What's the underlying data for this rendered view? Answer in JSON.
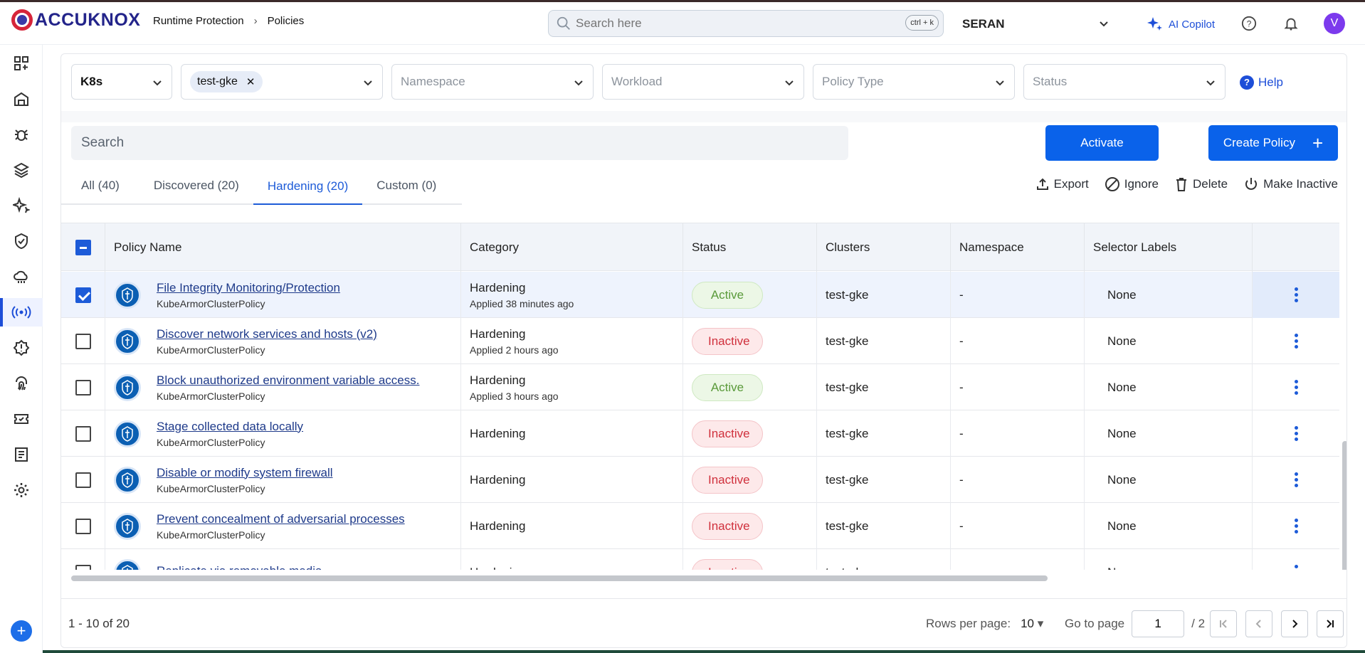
{
  "brand": {
    "name": "ACCUKNOX"
  },
  "breadcrumb": {
    "parent": "Runtime Protection",
    "current": "Policies"
  },
  "search": {
    "placeholder": "Search here",
    "shortcut": "ctrl + k"
  },
  "tenant": "SERAN",
  "copilot": "AI Copilot",
  "user_initial": "V",
  "sidebar": {
    "items": [
      "dashboard-icon",
      "inventory-icon",
      "bug-icon",
      "layers-icon",
      "sparkle-icon",
      "shield-check-icon",
      "cloud-icon",
      "runtime-icon",
      "alert-icon",
      "fingerprint-icon",
      "ticket-icon",
      "report-icon",
      "settings-icon"
    ],
    "active": "runtime-icon"
  },
  "filters": {
    "platform": "K8s",
    "cluster_chip": "test-gke",
    "namespace": "Namespace",
    "workload": "Workload",
    "policy_type": "Policy Type",
    "status": "Status",
    "help": "Help"
  },
  "search2": {
    "placeholder": "Search"
  },
  "buttons": {
    "activate": "Activate",
    "create": "Create Policy"
  },
  "tabs": [
    {
      "label": "All (40)"
    },
    {
      "label": "Discovered (20)"
    },
    {
      "label": "Hardening (20)",
      "active": true
    },
    {
      "label": "Custom (0)"
    }
  ],
  "actions": {
    "export": "Export",
    "ignore": "Ignore",
    "delete": "Delete",
    "inactive": "Make Inactive"
  },
  "columns": [
    "Policy Name",
    "Category",
    "Status",
    "Clusters",
    "Namespace",
    "Selector Labels"
  ],
  "rows": [
    {
      "name": "File Integrity Monitoring/Protection",
      "type": "KubeArmorClusterPolicy",
      "category": "Hardening",
      "applied": "Applied 38 minutes ago",
      "status": "Active",
      "cluster": "test-gke",
      "namespace": "-",
      "selector": "None",
      "checked": true
    },
    {
      "name": "Discover network services and hosts (v2)",
      "type": "KubeArmorClusterPolicy",
      "category": "Hardening",
      "applied": "Applied 2 hours ago",
      "status": "Inactive",
      "cluster": "test-gke",
      "namespace": "-",
      "selector": "None",
      "checked": false
    },
    {
      "name": "Block unauthorized environment variable access.",
      "type": "KubeArmorClusterPolicy",
      "category": "Hardening",
      "applied": "Applied 3 hours ago",
      "status": "Active",
      "cluster": "test-gke",
      "namespace": "-",
      "selector": "None",
      "checked": false
    },
    {
      "name": "Stage collected data locally",
      "type": "KubeArmorClusterPolicy",
      "category": "Hardening",
      "applied": "",
      "status": "Inactive",
      "cluster": "test-gke",
      "namespace": "-",
      "selector": "None",
      "checked": false
    },
    {
      "name": "Disable or modify system firewall",
      "type": "KubeArmorClusterPolicy",
      "category": "Hardening",
      "applied": "",
      "status": "Inactive",
      "cluster": "test-gke",
      "namespace": "-",
      "selector": "None",
      "checked": false
    },
    {
      "name": "Prevent concealment of adversarial processes",
      "type": "KubeArmorClusterPolicy",
      "category": "Hardening",
      "applied": "",
      "status": "Inactive",
      "cluster": "test-gke",
      "namespace": "-",
      "selector": "None",
      "checked": false
    },
    {
      "name": "Replicate via removable media",
      "type": "",
      "category": "Hardening",
      "applied": "",
      "status": "Inactive",
      "cluster": "test-gke",
      "namespace": "-",
      "selector": "None",
      "checked": false
    }
  ],
  "footer": {
    "range": "1 - 10 of 20",
    "rows_label": "Rows per page:",
    "rows_value": "10",
    "goto_label": "Go to page",
    "page": "1",
    "total_pages": "/ 2"
  }
}
